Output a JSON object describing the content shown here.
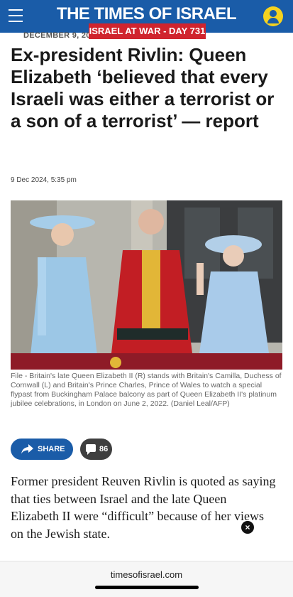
{
  "header": {
    "logo": "THE TIMES OF ISRAEL",
    "colors": {
      "bar": "#1a5ca8",
      "badge": "#d0242e",
      "user_icon": "#f5d21f"
    }
  },
  "dateline": "DECEMBER 9, 20",
  "badge": "ISRAEL AT WAR - DAY 731",
  "article": {
    "headline": "Ex-president Rivlin: Queen Elizabeth ‘believed that every Israeli was either a terrorist or a son of a terrorist’ — report",
    "published": "9 Dec 2024, 5:35 pm",
    "caption": "File - Britain's late Queen Elizabeth II (R) stands with Britain's Camilla, Duchess of Cornwall (L) and Britain's Prince Charles, Prince of Wales to watch a special flypast from Buckingham Palace balcony as part of Queen Elizabeth II's platinum jubilee celebrations, in London on June 2, 2022. (Daniel Leal/AFP)",
    "share_label": "SHARE",
    "comment_count": "86",
    "body": "Former president Reuven Rivlin is quoted as saying that ties between Israel and the late Queen Elizabeth II were “difficult” because of her views on the Jewish state."
  },
  "ad_close": "×",
  "browser": {
    "url": "timesofisrael.com"
  },
  "icons": [
    "menu-icon",
    "user-icon",
    "share-icon",
    "comment-icon",
    "close-icon"
  ]
}
